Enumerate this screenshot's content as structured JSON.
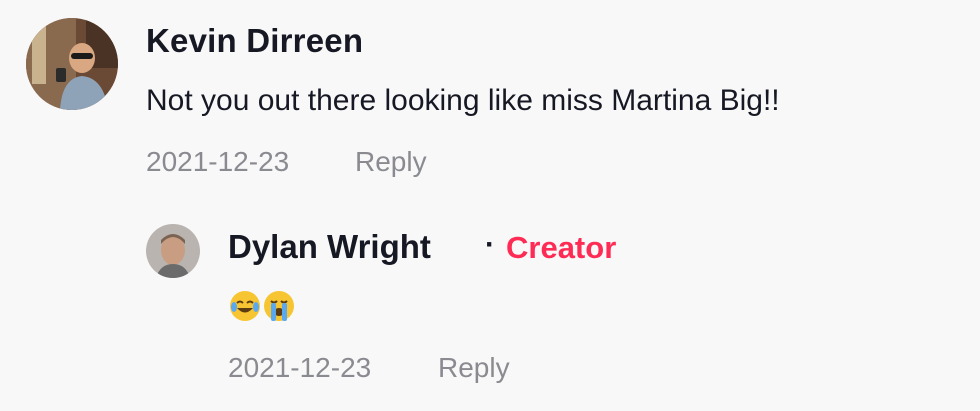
{
  "comments": [
    {
      "author": "Kevin Dirreen",
      "text": "Not you out there looking like miss Martina Big!!",
      "date": "2021-12-23",
      "reply_label": "Reply"
    }
  ],
  "reply": {
    "author": "Dylan Wright",
    "separator": "·",
    "badge": "Creator",
    "emojis": [
      "face-with-tears-of-joy",
      "loudly-crying-face"
    ],
    "date": "2021-12-23",
    "reply_label": "Reply"
  },
  "colors": {
    "background": "#f8f8f8",
    "text": "#161823",
    "muted": "#8a8b91",
    "creator_badge": "#fe2c55"
  }
}
